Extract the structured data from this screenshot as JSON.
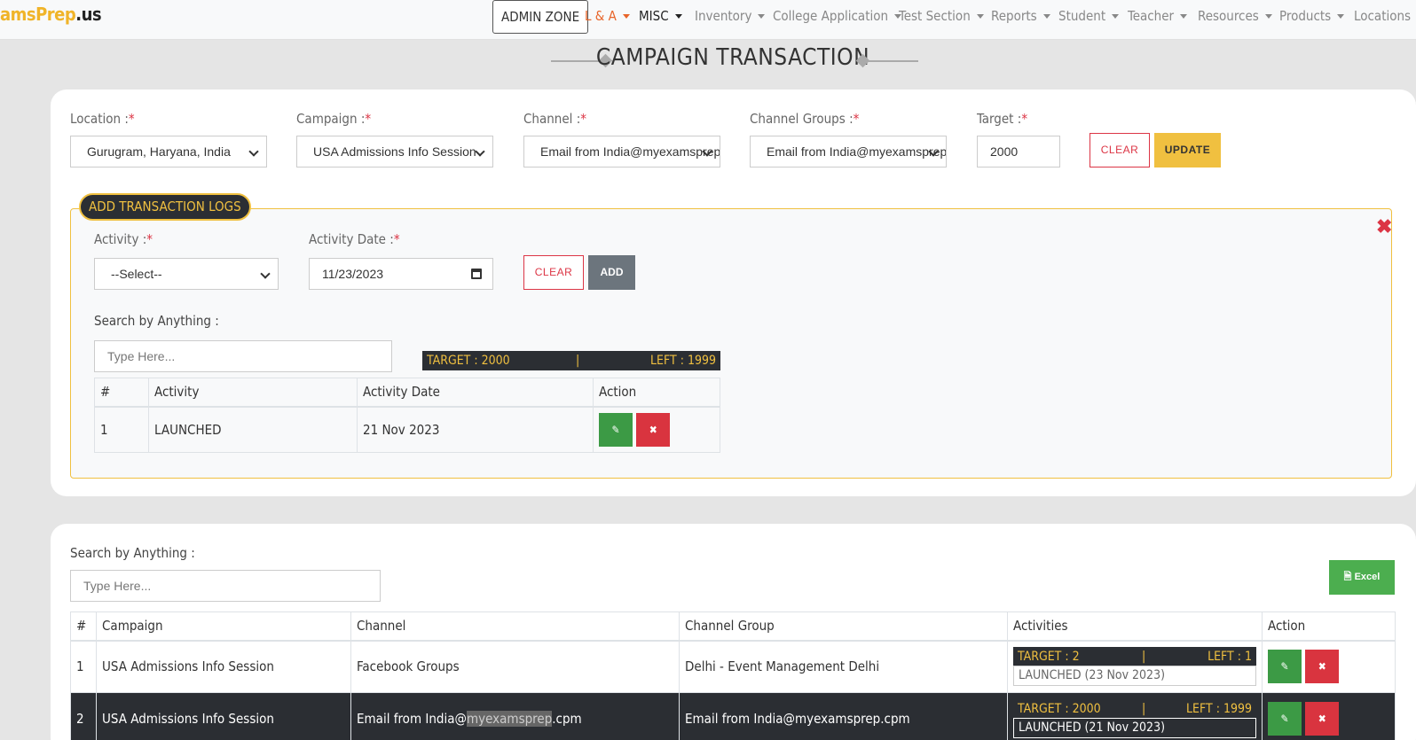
{
  "brand": {
    "part1": "amsPrep",
    "part2": ".us"
  },
  "nav": {
    "admin_zone": "ADMIN ZONE",
    "items": [
      "L & A",
      "MISC",
      "Inventory",
      "College Application",
      "Test Section",
      "Reports",
      "Student",
      "Teacher",
      "Resources",
      "Products",
      "Locations"
    ]
  },
  "page_title": "CAMPAIGN TRANSACTION",
  "form": {
    "location_label": "Location :",
    "location_value": "Gurugram, Haryana, India",
    "campaign_label": "Campaign :",
    "campaign_value": "USA Admissions Info Session",
    "channel_label": "Channel :",
    "channel_value": "Email from India@myexamsprep.cpm",
    "channel_group_label": "Channel Groups :",
    "channel_group_value": "Email from India@myexamsprep.cpm",
    "target_label": "Target :",
    "target_value": "2000",
    "required_mark": "*",
    "clear_label": "CLEAR",
    "update_label": "UPDATE"
  },
  "logs": {
    "badge": "ADD TRANSACTION LOGS",
    "close_icon": "close-icon",
    "activity_label": "Activity :",
    "activity_value": "--Select--",
    "date_label": "Activity Date :",
    "date_value": "11/23/2023",
    "clear_label": "CLEAR",
    "add_label": "ADD",
    "search_label": "Search by Anything :",
    "search_placeholder": "Type Here...",
    "target_text": "TARGET : 2000",
    "divider": "|",
    "left_text": "LEFT : 1999",
    "columns": [
      "#",
      "Activity",
      "Activity Date",
      "Action"
    ],
    "rows": [
      {
        "num": "1",
        "activity": "LAUNCHED",
        "date": "21 Nov 2023"
      }
    ]
  },
  "list": {
    "search_label": "Search by Anything :",
    "search_placeholder": "Type Here...",
    "excel_label": "Excel",
    "columns": [
      "#",
      "Campaign",
      "Channel",
      "Channel Group",
      "Activities",
      "Action"
    ],
    "rows": [
      {
        "num": "1",
        "campaign": "USA Admissions Info Session",
        "channel_pre": "Facebook Groups",
        "channel_hl": "",
        "channel_post": "",
        "group": "Delhi - Event Management Delhi",
        "target": "TARGET : 2",
        "left": "LEFT : 1",
        "activity": "LAUNCHED (23 Nov 2023)"
      },
      {
        "num": "2",
        "campaign": "USA Admissions Info Session",
        "channel_pre": "Email from India@",
        "channel_hl": "myexamsprep",
        "channel_post": ".cpm",
        "group": "Email from India@myexamsprep.cpm",
        "target": "TARGET : 2000",
        "left": "LEFT : 1999",
        "activity": "LAUNCHED (21 Nov 2023)"
      }
    ]
  },
  "colors": {
    "accent": "#f0c040",
    "danger": "#dc3545",
    "success": "#3c9a45",
    "dark": "#2b2e33"
  }
}
